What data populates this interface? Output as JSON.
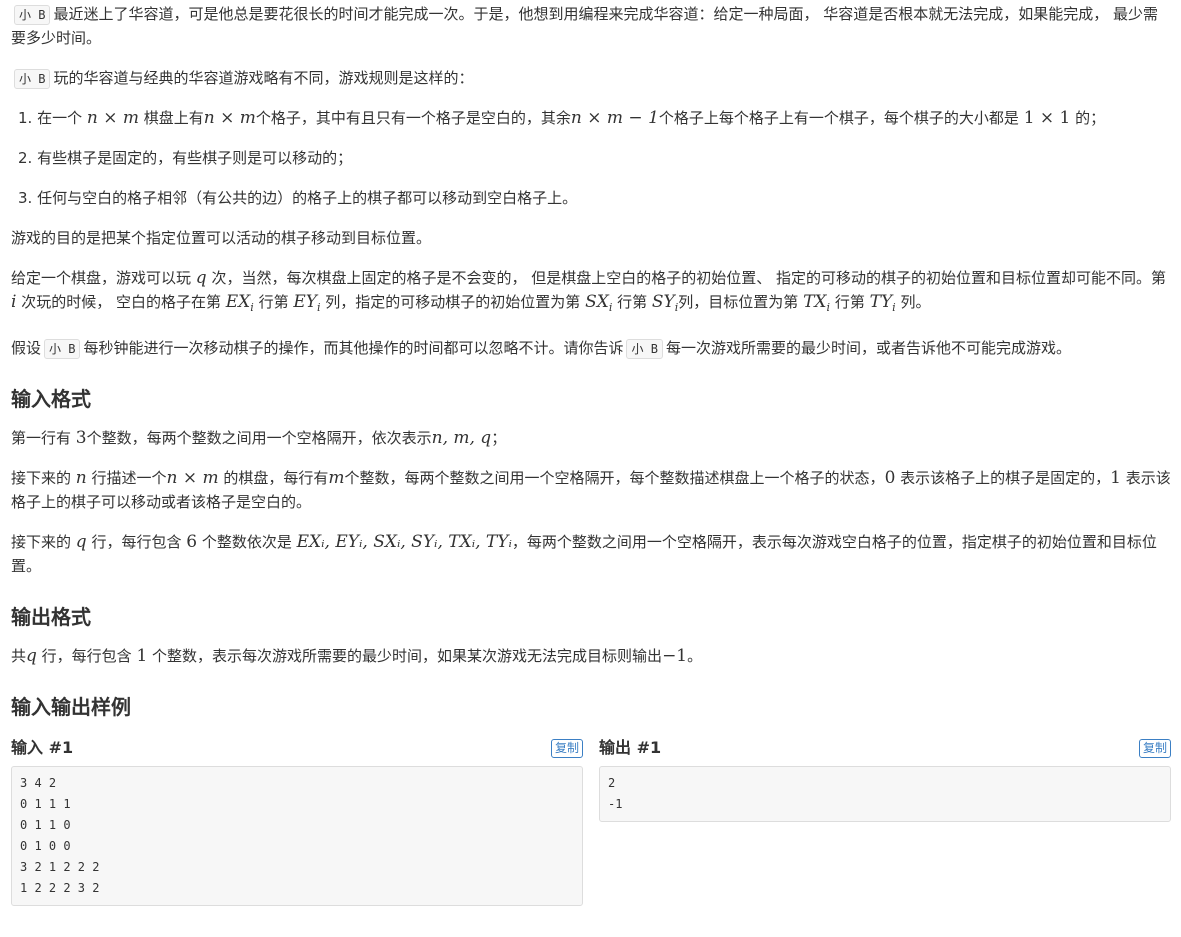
{
  "intro": {
    "tag": "小 B",
    "text": "最近迷上了华容道，可是他总是要花很长的时间才能完成一次。于是，他想到用编程来完成华容道：给定一种局面， 华容道是否根本就无法完成，如果能完成， 最少需要多少时间。"
  },
  "rules_intro": {
    "tag": "小 B",
    "text": "玩的华容道与经典的华容道游戏略有不同，游戏规则是这样的："
  },
  "rules": {
    "r1": {
      "a": "1. 在一个 ",
      "m1": "n × m",
      "b": " 棋盘上有",
      "m2": "n × m",
      "c": "个格子，其中有且只有一个格子是空白的，其余",
      "m3": "n × m − 1",
      "d": "个格子上每个格子上有一个棋子，每个棋子的大小都是 ",
      "m4": "1 × 1",
      "e": " 的；"
    },
    "r2": "2. 有些棋子是固定的，有些棋子则是可以移动的；",
    "r3": "3. 任何与空白的格子相邻（有公共的边）的格子上的棋子都可以移动到空白格子上。"
  },
  "goal": "游戏的目的是把某个指定位置可以活动的棋子移动到目标位置。",
  "para_q": {
    "a": "给定一个棋盘，游戏可以玩 ",
    "q": "q",
    "b": " 次，当然，每次棋盘上固定的格子是不会变的， 但是棋盘上空白的格子的初始位置、 指定的可移动的棋子的初始位置和目标位置却可能不同。第 ",
    "i": "i",
    "c": " 次玩的时候， 空白的格子在第 ",
    "ex": "EX",
    "d": " 行第 ",
    "ey": "EY",
    "e": " 列，指定的可移动棋子的初始位置为第 ",
    "sx": "SX",
    "f": " 行第 ",
    "sy": "SY",
    "g": "列，目标位置为第 ",
    "tx": "TX",
    "h": " 行第 ",
    "ty": "TY",
    "j": " 列。",
    "sub": "i"
  },
  "para_ask": {
    "a": "假设",
    "tag1": "小 B",
    "b": "每秒钟能进行一次移动棋子的操作，而其他操作的时间都可以忽略不计。请你告诉",
    "tag2": "小 B",
    "c": "每一次游戏所需要的最少时间，或者告诉他不可能完成游戏。"
  },
  "input_format": {
    "heading": "输入格式",
    "p1": {
      "a": "第一行有 ",
      "n3": "3",
      "b": "个整数，每两个整数之间用一个空格隔开，依次表示",
      "nmq": "n, m, q",
      "c": "；"
    },
    "p2": {
      "a": "接下来的 ",
      "n": "n",
      "b": " 行描述一个",
      "nm": "n × m",
      "c": " 的棋盘，每行有",
      "m": "m",
      "d": "个整数，每两个整数之间用一个空格隔开，每个整数描述棋盘上一个格子的状态，",
      "zero": "0",
      "e": " 表示该格子上的棋子是固定的，",
      "one": "1",
      "f": " 表示该格子上的棋子可以移动或者该格子是空白的。"
    },
    "p3": {
      "a": "接下来的 ",
      "q": "q",
      "b": " 行，每行包含 ",
      "six": "6",
      "c": " 个整数依次是 ",
      "vars": "EXᵢ, EYᵢ, SXᵢ, SYᵢ, TXᵢ, TYᵢ",
      "d": "，每两个整数之间用一个空格隔开，表示每次游戏空白格子的位置，指定棋子的初始位置和目标位置。"
    }
  },
  "output_format": {
    "heading": "输出格式",
    "p1": {
      "a": "共",
      "q": "q",
      "b": " 行，每行包含 ",
      "one": "1",
      "c": " 个整数，表示每次游戏所需要的最少时间，如果某次游戏无法完成目标则输出",
      "neg": "−1",
      "d": "。"
    }
  },
  "samples": {
    "heading": "输入输出样例",
    "input_title": "输入 #1",
    "output_title": "输出 #1",
    "copy_label": "复制",
    "input_text": "3 4 2\n0 1 1 1\n0 1 1 0\n0 1 0 0\n3 2 1 2 2 2\n1 2 2 2 3 2",
    "output_text": "2\n-1"
  }
}
